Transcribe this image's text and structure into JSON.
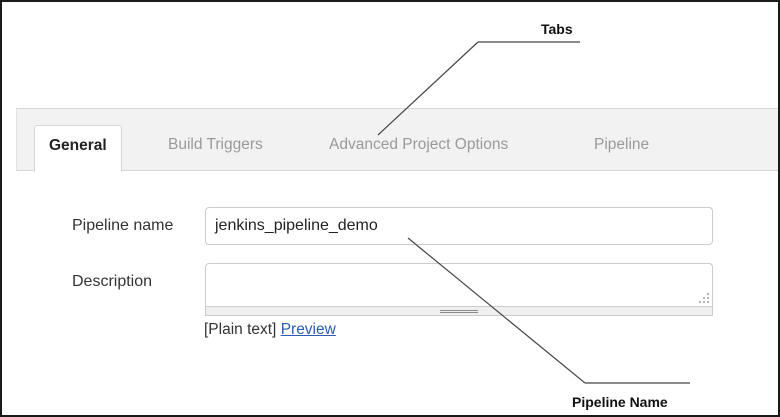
{
  "annotations": {
    "tabs_label": "Tabs",
    "pipeline_name_label": "Pipeline Name"
  },
  "tabs": [
    {
      "label": "General",
      "active": true
    },
    {
      "label": "Build Triggers",
      "active": false
    },
    {
      "label": "Advanced Project Options",
      "active": false
    },
    {
      "label": "Pipeline",
      "active": false
    }
  ],
  "form": {
    "pipeline_name_label": "Pipeline name",
    "pipeline_name_value": "jenkins_pipeline_demo",
    "description_label": "Description",
    "description_value": "",
    "help_prefix": "[Plain text]",
    "preview_link": "Preview"
  },
  "colors": {
    "tabbar_bg": "#f2f2f2",
    "link": "#2a5db0",
    "inactive_tab_text": "#9a9a9a"
  }
}
